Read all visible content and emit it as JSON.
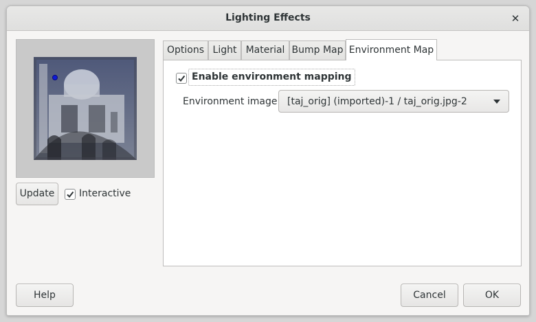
{
  "window": {
    "title": "Lighting Effects",
    "close_icon": "close-icon"
  },
  "preview": {
    "update_label": "Update",
    "interactive_label": "Interactive",
    "interactive_checked": true
  },
  "tabs": [
    {
      "label": "Options"
    },
    {
      "label": "Light"
    },
    {
      "label": "Material"
    },
    {
      "label": "Bump Map"
    },
    {
      "label": "Environment Map",
      "active": true
    }
  ],
  "env_map": {
    "enable_label": "Enable environment mapping",
    "enable_checked": true,
    "image_label": "Environment image:",
    "image_value": "[taj_orig] (imported)-1 / taj_orig.jpg-2"
  },
  "buttons": {
    "help": "Help",
    "cancel": "Cancel",
    "ok": "OK"
  },
  "colors": {
    "light_dot": "#0d1bd8",
    "window_bg": "#f6f5f4"
  }
}
